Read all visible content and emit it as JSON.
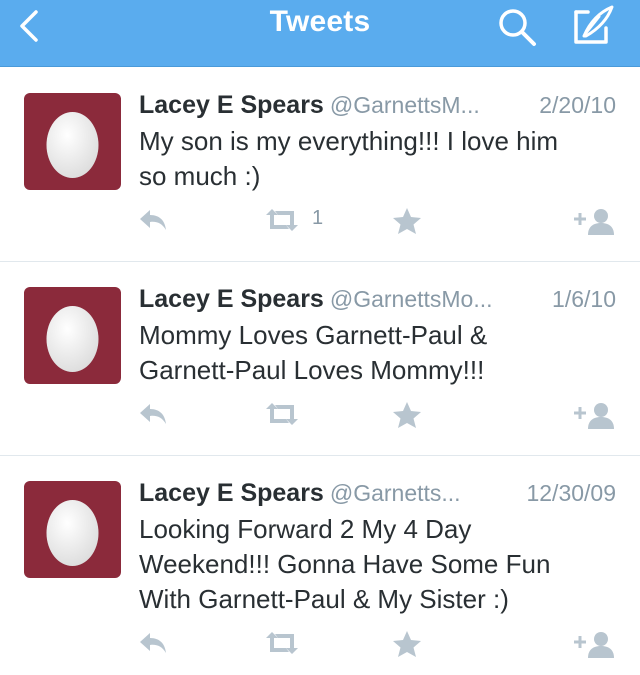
{
  "nav": {
    "title": "Tweets",
    "back_icon": "chevron-left-icon",
    "search_icon": "search-icon",
    "compose_icon": "compose-icon",
    "bar_color": "#5aacee"
  },
  "tweets": [
    {
      "name": "Lacey E Spears",
      "handle": "@GarnettsM...",
      "date": "2/20/10",
      "text_lines": [
        "My son is my everything!!! I love him",
        "so much :)"
      ],
      "retweet_count": "1"
    },
    {
      "name": "Lacey E Spears",
      "handle": "@GarnettsMo...",
      "date": "1/6/10",
      "text_lines": [
        "Mommy Loves Garnett-Paul &",
        "Garnett-Paul Loves Mommy!!!"
      ],
      "retweet_count": ""
    },
    {
      "name": "Lacey E Spears",
      "handle": "@Garnetts...",
      "date": "12/30/09",
      "text_lines": [
        "Looking Forward 2 My 4 Day",
        "Weekend!!! Gonna Have Some Fun",
        "With Garnett-Paul & My Sister :)"
      ],
      "retweet_count": ""
    }
  ],
  "colors": {
    "avatar_bg": "#8b2a3b",
    "muted": "#8899a6",
    "action_icon": "#b8c5cf"
  }
}
